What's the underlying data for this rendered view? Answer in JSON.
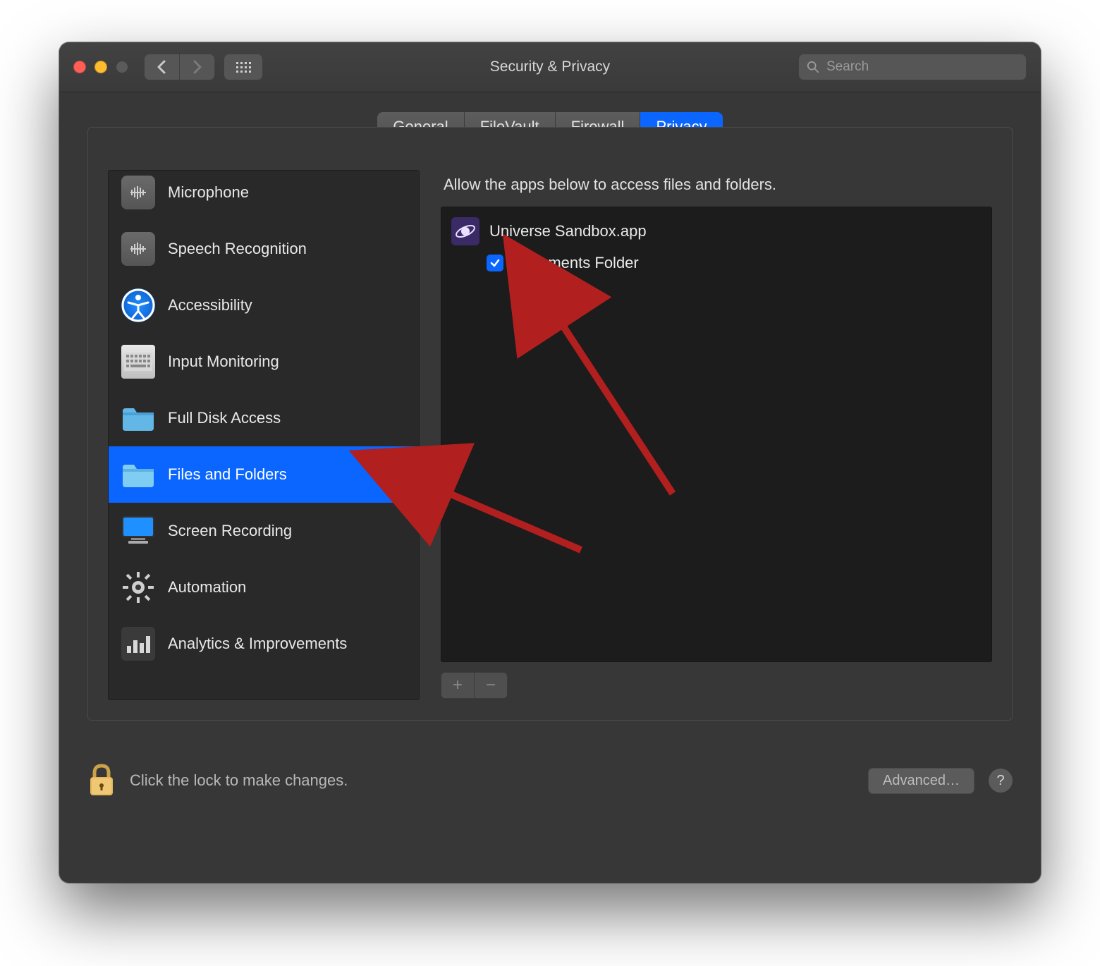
{
  "window": {
    "title": "Security & Privacy"
  },
  "search": {
    "placeholder": "Search"
  },
  "tabs": [
    {
      "label": "General",
      "active": false
    },
    {
      "label": "FileVault",
      "active": false
    },
    {
      "label": "Firewall",
      "active": false
    },
    {
      "label": "Privacy",
      "active": true
    }
  ],
  "sidebar": {
    "items": [
      {
        "label": "Microphone",
        "icon": "microphone-icon",
        "selected": false
      },
      {
        "label": "Speech Recognition",
        "icon": "speech-icon",
        "selected": false
      },
      {
        "label": "Accessibility",
        "icon": "accessibility-icon",
        "selected": false
      },
      {
        "label": "Input Monitoring",
        "icon": "keyboard-icon",
        "selected": false
      },
      {
        "label": "Full Disk Access",
        "icon": "folder-icon",
        "selected": false
      },
      {
        "label": "Files and Folders",
        "icon": "folder-icon",
        "selected": true
      },
      {
        "label": "Screen Recording",
        "icon": "monitor-icon",
        "selected": false
      },
      {
        "label": "Automation",
        "icon": "gear-icon",
        "selected": false
      },
      {
        "label": "Analytics & Improvements",
        "icon": "bars-icon",
        "selected": false
      }
    ]
  },
  "detail": {
    "headline": "Allow the apps below to access files and folders.",
    "apps": [
      {
        "name": "Universe Sandbox.app",
        "permissions": [
          {
            "label": "Documents Folder",
            "checked": true
          }
        ]
      }
    ]
  },
  "footer": {
    "lock_text": "Click the lock to make changes.",
    "advanced_label": "Advanced…"
  },
  "buttons": {
    "add": "+",
    "remove": "−"
  }
}
